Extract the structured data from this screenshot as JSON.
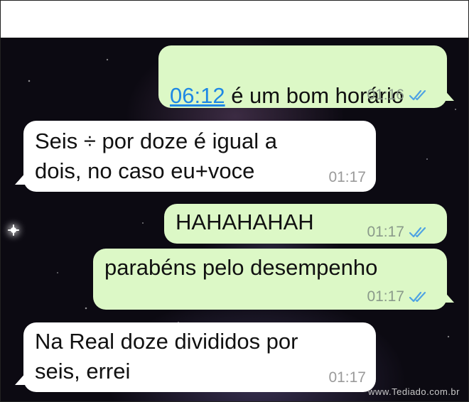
{
  "colors": {
    "outgoing_bubble": "#dcf8c6",
    "incoming_bubble": "#ffffff",
    "link": "#1e88e5",
    "read_ticks": "#4fa3e3"
  },
  "messages": [
    {
      "direction": "out",
      "link_text": "06:12",
      "text": " é um bom horário",
      "time": "01:16",
      "status": "read-double-check-icon"
    },
    {
      "direction": "in",
      "text": "Seis ÷ por doze é igual a\ndois, no caso eu+voce",
      "time": "01:17"
    },
    {
      "direction": "out",
      "text": "HAHAHAHAH",
      "time": "01:17",
      "status": "read-double-check-icon"
    },
    {
      "direction": "out",
      "text": "parabéns pelo desempenho",
      "time": "01:17",
      "status": "read-double-check-icon"
    },
    {
      "direction": "in",
      "text": "Na Real doze divididos por\nseis, errei",
      "time": "01:17"
    }
  ],
  "watermark": "www.Tediado.com.br"
}
